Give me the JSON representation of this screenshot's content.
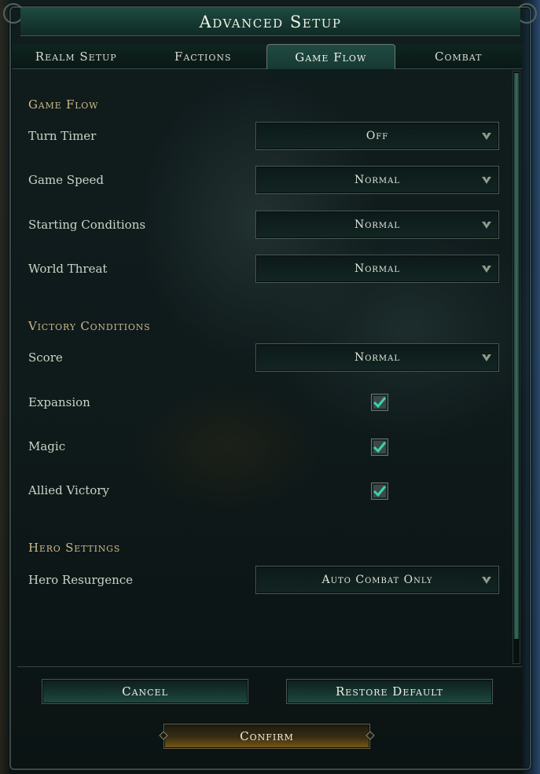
{
  "window": {
    "title": "Advanced Setup"
  },
  "tabs": [
    {
      "label": "Realm Setup",
      "active": false
    },
    {
      "label": "Factions",
      "active": false
    },
    {
      "label": "Game Flow",
      "active": true
    },
    {
      "label": "Combat",
      "active": false
    }
  ],
  "game_flow": {
    "heading": "Game Flow",
    "turn_timer": {
      "label": "Turn Timer",
      "value": "Off"
    },
    "game_speed": {
      "label": "Game Speed",
      "value": "Normal"
    },
    "starting_conditions": {
      "label": "Starting Conditions",
      "value": "Normal"
    },
    "world_threat": {
      "label": "World Threat",
      "value": "Normal"
    }
  },
  "victory": {
    "heading": "Victory Conditions",
    "score": {
      "label": "Score",
      "value": "Normal"
    },
    "expansion": {
      "label": "Expansion",
      "checked": true
    },
    "magic": {
      "label": "Magic",
      "checked": true
    },
    "allied_victory": {
      "label": "Allied Victory",
      "checked": true
    }
  },
  "hero": {
    "heading": "Hero Settings",
    "hero_resurgence": {
      "label": "Hero Resurgence",
      "value": "Auto Combat Only"
    }
  },
  "buttons": {
    "cancel": "Cancel",
    "restore_default": "Restore Default",
    "confirm": "Confirm"
  },
  "colors": {
    "accent_green": "#1f4a42",
    "section_gold": "#cdb98a",
    "check_teal": "#3fd0b0"
  },
  "icons": {
    "dropdown": "chevron-down-icon",
    "check": "check-icon"
  }
}
